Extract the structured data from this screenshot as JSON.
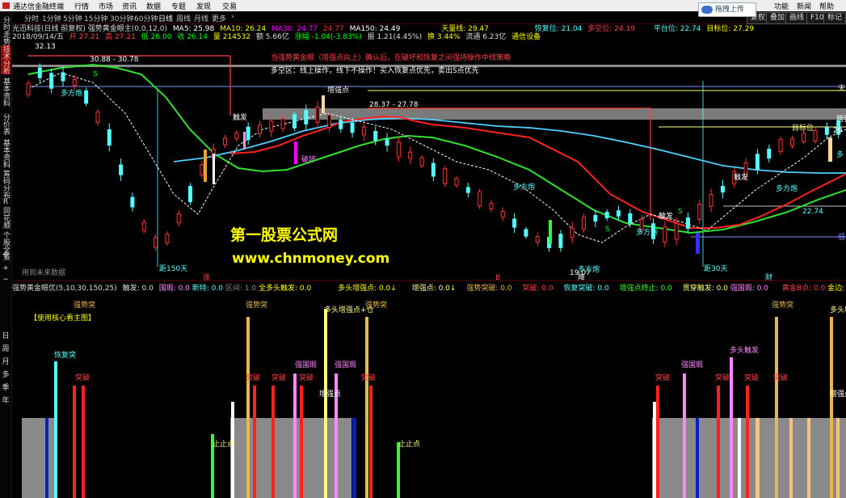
{
  "app": {
    "title": "通达信金融终端"
  },
  "menu": [
    "行情",
    "市场",
    "资讯",
    "数据",
    "专题",
    "发现",
    "交易"
  ],
  "window_menu": [
    "功能",
    "新闻",
    "帮助"
  ],
  "periods": [
    "分时",
    "1分钟",
    "5分钟",
    "15分钟",
    "30分钟",
    "60分钟",
    "日线",
    "周线",
    "月线",
    "更多"
  ],
  "active_period": "日线",
  "right_tabs": [
    "复权",
    "叠加",
    "画线",
    "F10",
    "标记"
  ],
  "upload_label": "拖拽上传",
  "sidebar_tabs": [
    "分时走势",
    "技术分析",
    "基本资料",
    "分价表",
    "基本资料",
    "筹码分布",
    "同花顺",
    "个股全景"
  ],
  "sidebar_bottom": [
    "日",
    "周",
    "月",
    "多",
    "季",
    "年"
  ],
  "title_line": {
    "name": "光迅科技(日线 前复权)",
    "formula": "强势黄金眼主(0,0,12,0)",
    "ma5": "MA5: 25.98",
    "ma10": "MA10: 26.24",
    "ma30": "MA30: 24.77",
    "up": "24.77",
    "ma150": "MA150: 24.49",
    "tianliang": "天量线: 29.47",
    "huifu": "恢复位: 21.04",
    "duokong": "多空位: 24.19",
    "pingtai": "平台位: 22.74",
    "target": "目标位: 27.29"
  },
  "info_line": {
    "date": "2018/09/14/五",
    "open": "开 27.21",
    "high": "高 27.21",
    "low": "低 26.00",
    "close": "收 26.14",
    "vol": "量 214532",
    "amount": "额 5.66亿",
    "chg": "涨幅 -1.04(-3.83%)",
    "amp": "振 1.21(4.45%)",
    "turn": "换 3.44%",
    "float": "流通 6.23亿",
    "sector": "通信设备"
  },
  "annotations": {
    "red_note_1": "当强势黄金眼（增强点向上）确认后，在破坏和恢复之间强持操作中线策略",
    "white_note_2": "多空区：线上操作，线下不操作！买入恢复点优先，卖出S点优先",
    "range_1": "30.88 - 30.78",
    "range_2": "28.37 - 27.78",
    "high_price": "32.13",
    "low_price": "19.07",
    "price_2274": "22.74",
    "price_2729": "29",
    "label_zengqiang": "增强点",
    "label_pohuai": "破坏",
    "label_huifu": "恢复",
    "label_duofangpao": "多方炮",
    "label_chufa": "触发",
    "label_day150": "距150天",
    "label_day30": "距30天",
    "label_future": "用到未来数据",
    "right_tian": "天",
    "right_di": "低",
    "right_duo": "多",
    "right_zeng": "增强",
    "target_lbl": "目标位",
    "mark_zhang": "涨",
    "mark_jiang": "降",
    "mark_cai": "财",
    "mark_s": "S",
    "mark_b": "B"
  },
  "watermark": {
    "line1": "第一股票公式网",
    "line2": "www.chnmoney.com"
  },
  "indicator_header": {
    "name": "强势黄金眼优(5,10,30,150,25)",
    "chufa": "触发: 0.0",
    "guoyi": "国瑕: 0.0",
    "zhongshu": "新特: 0.0",
    "quyu": "区间: 1.0",
    "quanduo": "全多头触发: 0.0",
    "duotou": "多头增强点: 0.0↓",
    "zengqiang": "增强点: 0.0↓",
    "qiangshi": "强势突破: 0.0",
    "tupo": "突破: 0.0",
    "huifu": "恢复突破: 0.0",
    "zengzhong": "增强点终止: 0.0",
    "guanchuan": "贯穿触发: 0.0",
    "qiangguo": "强国瑕: 0.0",
    "huangjin": "黄金B点: 0.0",
    "jinbian": "金边: 0.0↓"
  },
  "lower_labels": {
    "core": "【使用核心看主图】",
    "qiangshitu": "强势突",
    "huifutu": "恢复突",
    "tupo": "突破",
    "zhidian": "止止点",
    "duotouzq": "多头增强点+仓",
    "qiangguo": "强国瑕",
    "zengqiangdian": "增强点",
    "duotouchufa": "多头触发"
  },
  "colors": {
    "ma5": "#ffffff",
    "ma10": "#ffff00",
    "ma30": "#ff00ff",
    "ma150": "#00ff00",
    "up": "#ff3232",
    "down": "#54ffff",
    "gold": "#e8b84a",
    "accent_red": "#ff4040"
  },
  "chart_data": {
    "type": "candlestick",
    "ylim": [
      17.5,
      34
    ],
    "series": [
      {
        "name": "MA150",
        "color": "green"
      },
      {
        "name": "MA30",
        "color": "cyan"
      },
      {
        "name": "MA10",
        "color": "red"
      }
    ],
    "horizontal_levels": [
      {
        "name": "天量线",
        "value": 29.47
      },
      {
        "name": "恢复位",
        "value": 21.04
      },
      {
        "name": "多空位",
        "value": 24.19
      },
      {
        "name": "平台位",
        "value": 22.74
      },
      {
        "name": "目标位",
        "value": 27.29
      }
    ]
  }
}
